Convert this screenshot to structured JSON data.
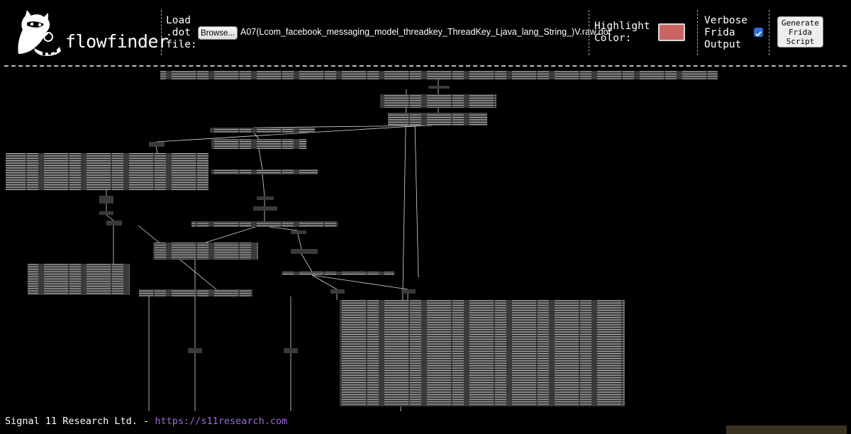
{
  "app": {
    "name": "flowfinder"
  },
  "toolbar": {
    "load_label": "Load\n.dot\nfile:",
    "browse_label": "Browse...",
    "file_name": "A07(Lcom_facebook_messaging_model_threadkey_ThreadKey_Ljava_lang_String_)V.raw.dot",
    "highlight_label": "Highlight\nColor:",
    "highlight_color": "#cd6464",
    "verbose_label": "Verbose\nFrida\nOutput",
    "verbose_checked": true,
    "generate_label": "Generate\nFrida\nScript"
  },
  "footer": {
    "company": "Signal 11 Research Ltd. -",
    "link_text": "https://s11research.com"
  },
  "colors": {
    "background": "#000000",
    "node_fill": "#3a3a3a",
    "edge": "#d8d8d8",
    "link": "#9b6bd6"
  }
}
